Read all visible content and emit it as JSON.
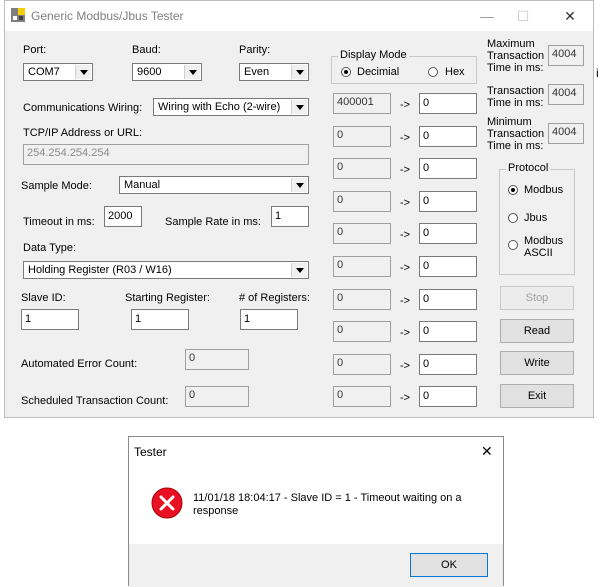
{
  "window": {
    "title": "Generic Modbus/Jbus Tester",
    "minimize": "—",
    "maximize": "☐",
    "close": "✕"
  },
  "port": {
    "label": "Port:",
    "value": "COM7"
  },
  "baud": {
    "label": "Baud:",
    "value": "9600"
  },
  "parity": {
    "label": "Parity:",
    "value": "Even"
  },
  "wiring": {
    "label": "Communications Wiring:",
    "value": "Wiring with Echo (2-wire)"
  },
  "tcp": {
    "label": "TCP/IP Address or URL:",
    "value": "254.254.254.254"
  },
  "sample_mode": {
    "label": "Sample Mode:",
    "value": "Manual"
  },
  "timeout": {
    "label": "Timeout in ms:",
    "value": "2000"
  },
  "sample_rate": {
    "label": "Sample Rate in ms:",
    "value": "1"
  },
  "data_type": {
    "label": "Data Type:",
    "value": "Holding Register (R03 / W16)"
  },
  "slave_id": {
    "label": "Slave ID:",
    "value": "1"
  },
  "starting_register": {
    "label": "Starting Register:",
    "value": "1"
  },
  "num_registers": {
    "label": "# of Registers:",
    "value": "1"
  },
  "error_count": {
    "label": "Automated Error Count:",
    "value": "0"
  },
  "sched_count": {
    "label": "Scheduled Transaction Count:",
    "value": "0"
  },
  "display_mode": {
    "label": "Display Mode",
    "decimal": "Decimial",
    "hex": "Hex",
    "selected": "decimal"
  },
  "arrow": "->",
  "registers": [
    {
      "addr": "400001",
      "value": "0"
    },
    {
      "addr": "0",
      "value": "0"
    },
    {
      "addr": "0",
      "value": "0"
    },
    {
      "addr": "0",
      "value": "0"
    },
    {
      "addr": "0",
      "value": "0"
    },
    {
      "addr": "0",
      "value": "0"
    },
    {
      "addr": "0",
      "value": "0"
    },
    {
      "addr": "0",
      "value": "0"
    },
    {
      "addr": "0",
      "value": "0"
    },
    {
      "addr": "0",
      "value": "0"
    }
  ],
  "max_time": {
    "line1": "Maximum",
    "line2": "Transaction",
    "line3": "Time in ms:",
    "value": "4004"
  },
  "trans_time": {
    "line1": "Transaction",
    "line2": "Time in ms:",
    "value": "4004"
  },
  "min_time": {
    "line1": "Minimum",
    "line2": "Transaction",
    "line3": "Time in ms:",
    "value": "4004"
  },
  "protocol": {
    "label": "Protocol",
    "modbus": "Modbus",
    "jbus": "Jbus",
    "ascii1": "Modbus",
    "ascii2": "ASCII",
    "selected": "modbus"
  },
  "buttons": {
    "stop": "Stop",
    "read": "Read",
    "write": "Write",
    "exit": "Exit"
  },
  "stray_text": "i",
  "dialog": {
    "title": "Tester",
    "close": "✕",
    "message_line1": "11/01/18 18:04:17 - Slave ID = 1 - Timeout waiting on a",
    "message_line2": "response",
    "ok": "OK"
  },
  "colors": {
    "error_red": "#e81123",
    "window_bg": "#f0f0f0",
    "focus_blue": "#0078d7"
  }
}
